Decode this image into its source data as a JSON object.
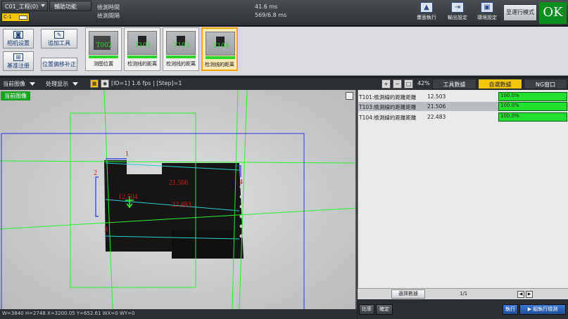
{
  "header": {
    "project_menu": "C01_工程(0)",
    "help_menu": "輔助功能",
    "mode_tab": "C-1",
    "timing": {
      "detect_time_label": "檢測時間",
      "detect_time_value": "41.6 ms",
      "detect_interval_label": "檢測間隔",
      "detect_interval_value": "569/6.8 ms"
    },
    "toolbar_icons": [
      {
        "label": "畫面執行",
        "icon": "run-icon"
      },
      {
        "label": "輸出設定",
        "icon": "output-icon"
      },
      {
        "label": "環境設定",
        "icon": "environment-icon"
      }
    ],
    "run_mode_button": "至運行模式",
    "result": "OK"
  },
  "toolbar2": {
    "camera_settings": "相机设置",
    "add_tool": "追加工具",
    "register_base": "基准注册",
    "position_offset": "位置偏移补正",
    "tools": [
      {
        "num": "T002",
        "label": "测图位置"
      },
      {
        "num": "T101",
        "label": "检测线的距离"
      },
      {
        "num": "T103",
        "label": "检测线的距离"
      },
      {
        "num": "T104",
        "label": "检测线的距离"
      }
    ]
  },
  "image_toolbar": {
    "image_select": "当前图像",
    "display_select": "处理显示",
    "fps_text": "[ID=1] 1.6 fps | [Step]=1",
    "zoom_percent": "42%",
    "tabs": [
      "工具數據",
      "自選數據",
      "NG窗口"
    ]
  },
  "image_view": {
    "current_image_tag": "当前图像",
    "measure_labels": [
      "1",
      "2",
      "3",
      "4"
    ],
    "measurements": {
      "m1": "21.506",
      "m2": "22.483",
      "m3": "12.504"
    },
    "status_text": "W=3840 H=2748 X=3200.05 Y=652.61 WX=0 WY=0"
  },
  "data_panel": {
    "rows": [
      {
        "name": "T101:檢測線的距離距離",
        "value": "12.503",
        "pct": "100.0%"
      },
      {
        "name": "T103:檢測線的距離距離",
        "value": "21.506",
        "pct": "100.0%"
      },
      {
        "name": "T104:檢測線的距離距離",
        "value": "22.483",
        "pct": "100.0%"
      }
    ],
    "select_data_button": "選擇數據",
    "page": "1/1"
  },
  "footer": {
    "compare_button": "比率",
    "confirm_button": "確定",
    "execute_button": "執行",
    "run_detect_button": "組執行檢測"
  },
  "colors": {
    "ok_green": "#0a8f1e",
    "active_tab": "#f3c600",
    "overlay_green": "#2cf02c",
    "overlay_blue": "#2a35e0",
    "measure_red": "#d81a1a",
    "measure_cyan": "#29d0d0"
  }
}
